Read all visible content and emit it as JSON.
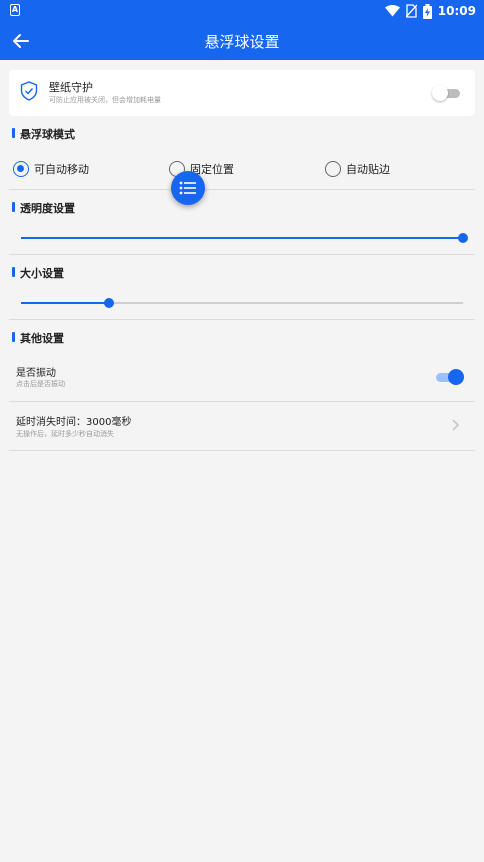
{
  "statusbar": {
    "app_badge": "A",
    "time": "10:09"
  },
  "appbar": {
    "title": "悬浮球设置"
  },
  "wallpaper_guard": {
    "title": "壁纸守护",
    "subtitle": "可防止应用被关闭，但会增加耗电量",
    "enabled": false
  },
  "mode_section": {
    "title": "悬浮球模式",
    "options": [
      {
        "label": "可自动移动",
        "selected": true
      },
      {
        "label": "固定位置",
        "selected": false
      },
      {
        "label": "自动贴边",
        "selected": false
      }
    ]
  },
  "opacity_section": {
    "title": "透明度设置",
    "value_fraction": 1.0
  },
  "size_section": {
    "title": "大小设置",
    "value_fraction": 0.2
  },
  "other_section": {
    "title": "其他设置",
    "vibrate": {
      "title": "是否振动",
      "subtitle": "点击后是否振动",
      "enabled": true
    },
    "delay": {
      "title": "延时消失时间：3000毫秒",
      "subtitle": "无操作后，延时多少秒自动消失"
    }
  },
  "colors": {
    "accent": "#1766f0",
    "background": "#f4f4f4"
  },
  "icons": [
    "app-badge-icon",
    "wifi-icon",
    "no-sim-icon",
    "battery-charging-icon",
    "back-arrow-icon",
    "shield-check-icon",
    "chevron-right-icon",
    "list-icon"
  ]
}
